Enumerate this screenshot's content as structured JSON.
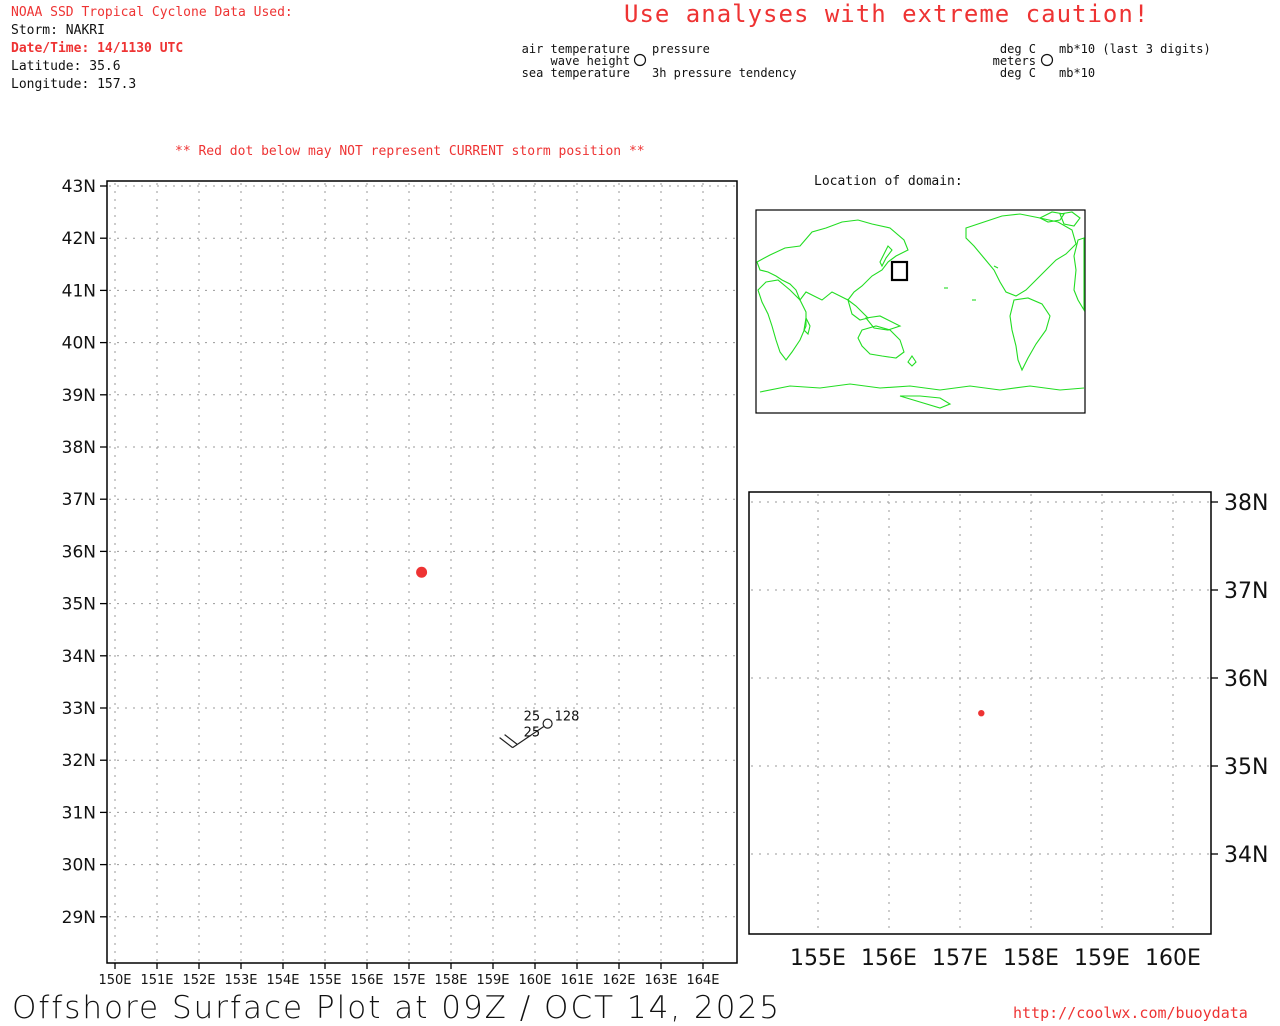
{
  "header": {
    "source_label": "NOAA SSD Tropical Cyclone Data Used:",
    "storm": "Storm: NAKRI",
    "datetime": "Date/Time: 14/1130 UTC",
    "latitude": "Latitude: 35.6",
    "longitude": "Longitude: 157.3",
    "warning": "Use analyses with extreme caution!"
  },
  "legend": {
    "left": [
      "air temperature",
      "wave height",
      "sea temperature"
    ],
    "right": [
      "pressure",
      "3h pressure tendency"
    ],
    "units_left": [
      "deg C",
      "meters",
      "deg C"
    ],
    "units_right": [
      "mb*10 (last 3 digits)",
      "mb*10"
    ]
  },
  "notice": "** Red dot below may NOT represent CURRENT storm position **",
  "inset_title": "Location of domain:",
  "main_map": {
    "lat_labels": [
      "43N",
      "42N",
      "41N",
      "40N",
      "39N",
      "38N",
      "37N",
      "36N",
      "35N",
      "34N",
      "33N",
      "32N",
      "31N",
      "30N",
      "29N"
    ],
    "lon_labels": [
      "150E",
      "151E",
      "152E",
      "153E",
      "154E",
      "155E",
      "156E",
      "157E",
      "158E",
      "159E",
      "160E",
      "161E",
      "162E",
      "163E",
      "164E"
    ],
    "storm_lat": 35.6,
    "storm_lon": 157.3,
    "station": {
      "lat": 32.7,
      "lon": 160.3,
      "air_temp": "25",
      "sea_temp": "25",
      "pressure": "128"
    }
  },
  "zoom_map": {
    "lat_labels": [
      "38N",
      "37N",
      "36N",
      "35N",
      "34N"
    ],
    "lon_labels": [
      "155E",
      "156E",
      "157E",
      "158E",
      "159E",
      "160E"
    ]
  },
  "footer": {
    "title": "Offshore Surface Plot at 09Z / OCT 14, 2025",
    "url": "http://coolwx.com/buoydata"
  },
  "colors": {
    "accent_red": "#ee3333",
    "coast_green": "#22dd22"
  }
}
